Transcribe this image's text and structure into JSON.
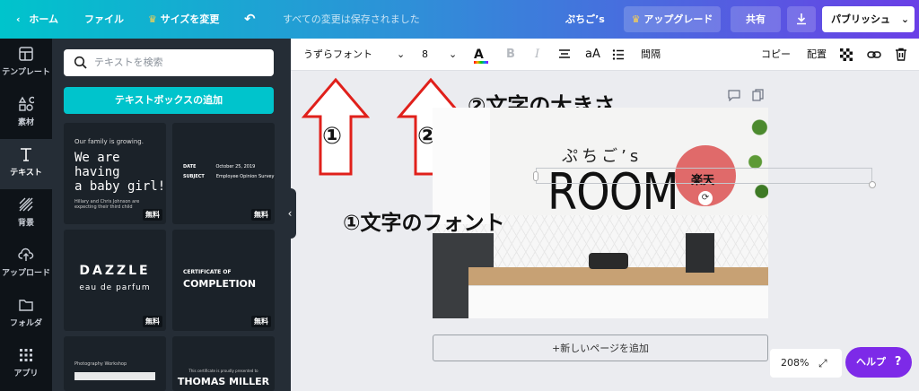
{
  "topbar": {
    "home": "ホーム",
    "file": "ファイル",
    "resize": "サイズを変更",
    "saved_status": "すべての変更は保存されました",
    "design_name": "ぷちご’s",
    "upgrade": "アップグレード",
    "share": "共有",
    "publish": "パブリッシュ"
  },
  "rail": {
    "items": [
      {
        "label": "テンプレート"
      },
      {
        "label": "素材"
      },
      {
        "label": "テキスト"
      },
      {
        "label": "背景"
      },
      {
        "label": "アップロード"
      },
      {
        "label": "フォルダ"
      },
      {
        "label": "アプリ"
      }
    ]
  },
  "panel": {
    "search_placeholder": "テキストを検索",
    "add_textbox": "テキストボックスの追加",
    "free_badge": "無料",
    "templates": [
      {
        "line1": "Our family is growing.",
        "line2": "We are having",
        "line3": "a baby girl!",
        "line4": "Hillary and Chris Johnson are",
        "line5": "expecting their third child"
      },
      {
        "line1": "DATE",
        "line2": "October 25, 2019",
        "line3": "SUBJECT",
        "line4": "Employee Opinion Survey"
      },
      {
        "line1": "DAZZLE",
        "line2": "eau de parfum"
      },
      {
        "line1": "CERTIFICATE OF",
        "line2": "COMPLETION"
      },
      {
        "line1": "Photography Workshop"
      },
      {
        "line1": "This certificate is proudly presented to",
        "line2": "THOMAS MILLER"
      }
    ]
  },
  "toolbar": {
    "font_name": "うずらフォント",
    "font_size": "8",
    "text_color_letter": "A",
    "bold": "B",
    "italic": "I",
    "case": "aA",
    "spacing": "間隔",
    "copy": "コピー",
    "position": "配置"
  },
  "annotations": {
    "num1": "①",
    "num2": "②",
    "size_label": "②文字の大きさ",
    "font_label": "①文字のフォント"
  },
  "design": {
    "subtitle": "ぷちご’s",
    "title": "ROOM",
    "badge": "楽天"
  },
  "canvas": {
    "add_page": "+新しいページを追加",
    "zoom": "208%",
    "help": "ヘルプ",
    "help_icon": "?"
  },
  "colors": {
    "accent_teal": "#00c4cc",
    "accent_purple": "#7d2ae8",
    "arrow_red": "#e0201b",
    "badge_red": "#e06a6a"
  }
}
